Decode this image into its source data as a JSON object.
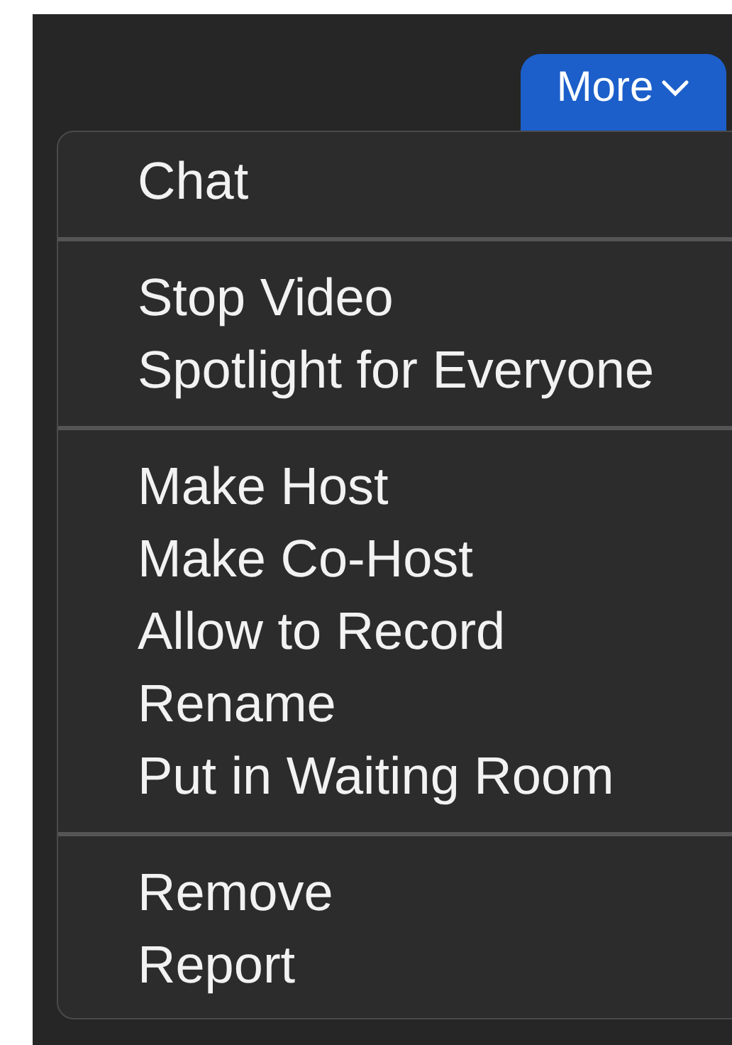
{
  "more_button": {
    "label": "More"
  },
  "menu": {
    "groups": [
      {
        "items": [
          "Chat"
        ]
      },
      {
        "items": [
          "Stop Video",
          "Spotlight for Everyone"
        ]
      },
      {
        "items": [
          "Make Host",
          "Make Co-Host",
          "Allow to Record",
          "Rename",
          "Put in Waiting Room"
        ]
      },
      {
        "items": [
          "Remove",
          "Report"
        ]
      }
    ]
  }
}
